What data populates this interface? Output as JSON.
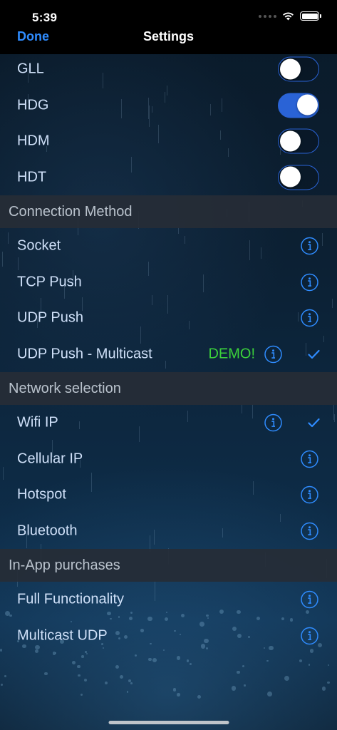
{
  "status_bar": {
    "time": "5:39"
  },
  "nav": {
    "done_label": "Done",
    "title": "Settings"
  },
  "sentences": [
    {
      "label": "GLL",
      "enabled": false
    },
    {
      "label": "HDG",
      "enabled": true
    },
    {
      "label": "HDM",
      "enabled": false
    },
    {
      "label": "HDT",
      "enabled": false
    }
  ],
  "connection_method": {
    "header": "Connection Method",
    "items": [
      {
        "label": "Socket"
      },
      {
        "label": "TCP Push"
      },
      {
        "label": "UDP Push"
      },
      {
        "label": "UDP Push - Multicast",
        "badge": "DEMO!",
        "selected": true
      }
    ]
  },
  "network_selection": {
    "header": "Network selection",
    "items": [
      {
        "label": "Wifi IP",
        "selected": true
      },
      {
        "label": "Cellular IP"
      },
      {
        "label": "Hotspot"
      },
      {
        "label": "Bluetooth"
      }
    ]
  },
  "in_app_purchases": {
    "header": "In-App purchases",
    "items": [
      {
        "label": "Full Functionality"
      },
      {
        "label": "Multicast UDP"
      }
    ]
  },
  "colors": {
    "accent": "#2f8cff",
    "toggle_on": "#2a63d6",
    "demo": "#3bd23b",
    "header_bg": "#262c36"
  }
}
